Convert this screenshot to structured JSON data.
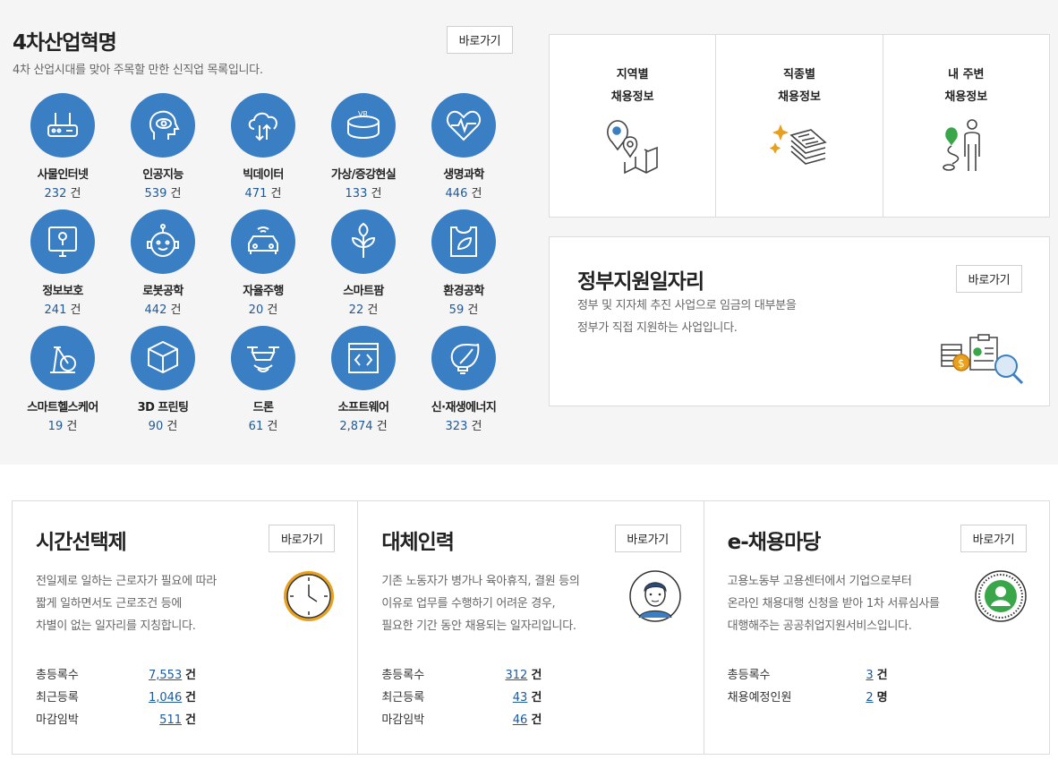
{
  "industry": {
    "title": "4차산업혁명",
    "description": "4차 산업시대를 맞아 주목할 만한 신직업 목록입니다.",
    "goto_label": "바로가기",
    "unit": "건",
    "items": [
      {
        "name": "사물인터넷",
        "count": "232",
        "icon": "router-icon"
      },
      {
        "name": "인공지능",
        "count": "539",
        "icon": "ai-head-icon"
      },
      {
        "name": "빅데이터",
        "count": "471",
        "icon": "cloud-data-icon"
      },
      {
        "name": "가상/증강현실",
        "count": "133",
        "icon": "vr-icon"
      },
      {
        "name": "생명과학",
        "count": "446",
        "icon": "heart-pulse-icon"
      },
      {
        "name": "정보보호",
        "count": "241",
        "icon": "lock-monitor-icon"
      },
      {
        "name": "로봇공학",
        "count": "442",
        "icon": "robot-icon"
      },
      {
        "name": "자율주행",
        "count": "20",
        "icon": "car-icon"
      },
      {
        "name": "스마트팜",
        "count": "22",
        "icon": "sprout-icon"
      },
      {
        "name": "환경공학",
        "count": "59",
        "icon": "eco-bag-icon"
      },
      {
        "name": "스마트헬스케어",
        "count": "19",
        "icon": "exercise-bike-icon"
      },
      {
        "name": "3D 프린팅",
        "count": "90",
        "icon": "cube-icon"
      },
      {
        "name": "드론",
        "count": "61",
        "icon": "drone-icon"
      },
      {
        "name": "소프트웨어",
        "count": "2,874",
        "icon": "code-window-icon"
      },
      {
        "name": "신·재생에너지",
        "count": "323",
        "icon": "leaf-bulb-icon"
      }
    ]
  },
  "info_boxes": [
    {
      "line1": "지역별",
      "line2": "채용정보",
      "icon": "map-pin-icon"
    },
    {
      "line1": "직종별",
      "line2": "채용정보",
      "icon": "stacked-docs-icon"
    },
    {
      "line1": "내 주변",
      "line2": "채용정보",
      "icon": "person-location-icon"
    }
  ],
  "gov": {
    "title": "정부지원일자리",
    "desc1": "정부 및 지자체 추진 사업으로 임금의 대부분을",
    "desc2": "정부가 직접 지원하는 사업입니다.",
    "goto_label": "바로가기",
    "icon": "money-search-icon"
  },
  "bottom": [
    {
      "title": "시간선택제",
      "goto_label": "바로가기",
      "desc": [
        "전일제로 일하는 근로자가 필요에 따라",
        "짧게 일하면서도 근로조건 등에",
        "차별이 없는 일자리를 지칭합니다."
      ],
      "icon": "clock-icon",
      "stats": [
        {
          "label": "총등록수",
          "value": "7,553",
          "unit": "건"
        },
        {
          "label": "최근등록",
          "value": "1,046",
          "unit": "건"
        },
        {
          "label": "마감임박",
          "value": "511",
          "unit": "건"
        }
      ]
    },
    {
      "title": "대체인력",
      "goto_label": "바로가기",
      "desc": [
        "기존 노동자가 병가나 육아휴직, 결원 등의",
        "이유로 업무를 수행하기 어려운 경우,",
        "필요한 기간 동안 채용되는 일자리입니다."
      ],
      "icon": "worker-avatar-icon",
      "stats": [
        {
          "label": "총등록수",
          "value": "312",
          "unit": "건"
        },
        {
          "label": "최근등록",
          "value": "43",
          "unit": "건"
        },
        {
          "label": "마감임박",
          "value": "46",
          "unit": "건"
        }
      ]
    },
    {
      "title": "e-채용마당",
      "goto_label": "바로가기",
      "desc": [
        "고용노동부 고용센터에서 기업으로부터",
        "온라인 채용대행 신청을 받아 1차 서류심사를",
        "대행해주는 공공취업지원서비스입니다."
      ],
      "icon": "stamp-avatar-icon",
      "stats": [
        {
          "label": "총등록수",
          "value": "3",
          "unit": "건"
        },
        {
          "label": "채용예정인원",
          "value": "2",
          "unit": "명"
        }
      ]
    }
  ]
}
